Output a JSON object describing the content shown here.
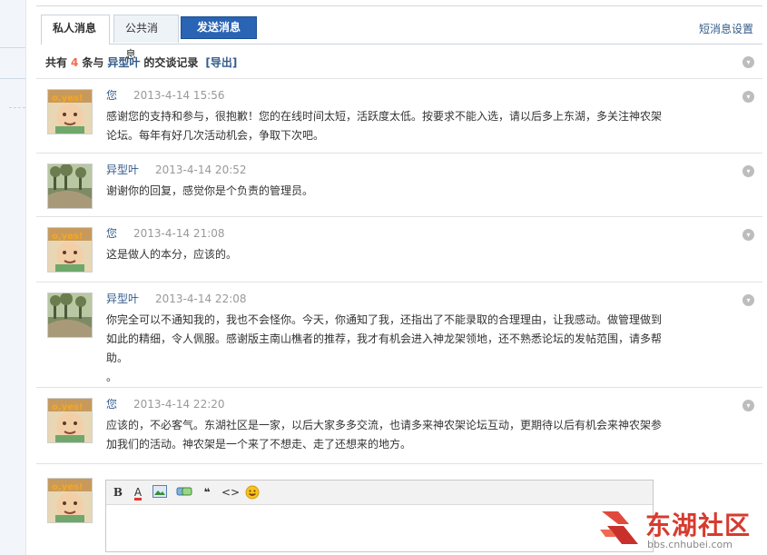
{
  "tabs": {
    "private": "私人消息",
    "public": "公共消息",
    "send": "发送消息",
    "settings": "短消息设置"
  },
  "summary": {
    "prefix": "共有",
    "count": "4",
    "middle": "条与",
    "name": "异型叶",
    "suffix": "的交谈记录",
    "export": "[导出]"
  },
  "messages": [
    {
      "author": "您",
      "time": "2013-4-14 15:56",
      "avatar": "baby-avatar",
      "text": "感谢您的支持和参与，很抱歉！您的在线时间太短，活跃度太低。按要求不能入选，请以后多上东湖，多关注神农架论坛。每年有好几次活动机会，争取下次吧。"
    },
    {
      "author": "异型叶",
      "time": "2013-4-14 20:52",
      "avatar": "landscape-avatar",
      "text": "谢谢你的回复，感觉你是个负责的管理员。"
    },
    {
      "author": "您",
      "time": "2013-4-14 21:08",
      "avatar": "baby-avatar",
      "text": "这是做人的本分，应该的。"
    },
    {
      "author": "异型叶",
      "time": "2013-4-14 22:08",
      "avatar": "landscape-avatar",
      "text": "你完全可以不通知我的，我也不会怪你。今天，你通知了我，还指出了不能录取的合理理由，让我感动。做管理做到如此的精细，令人佩服。感谢版主南山樵者的推荐，我才有机会进入神龙架领地，还不熟悉论坛的发帖范围，请多帮助。",
      "text2": "。"
    },
    {
      "author": "您",
      "time": "2013-4-14 22:20",
      "avatar": "baby-avatar",
      "text": "应该的，不必客气。东湖社区是一家，以后大家多多交流，也请多来神农架论坛互动，更期待以后有机会来神农架参加我们的活动。神农架是一个来了不想走、走了还想来的地方。"
    }
  ],
  "editor": {
    "toolbar": [
      "bold-icon",
      "font-color-icon",
      "image-icon",
      "link-icon",
      "quote-icon",
      "code-icon",
      "smiley-icon"
    ],
    "bold_label": "B",
    "color_label": "A",
    "quote_label": "❝",
    "code_label": "<>"
  },
  "watermark": {
    "text": "东湖社区",
    "url": "bbs.cnhubei.com"
  },
  "colors": {
    "accent": "#2a64b4",
    "link": "#335b8a",
    "count": "#f26c4f",
    "watermark": "#d63b2e"
  }
}
